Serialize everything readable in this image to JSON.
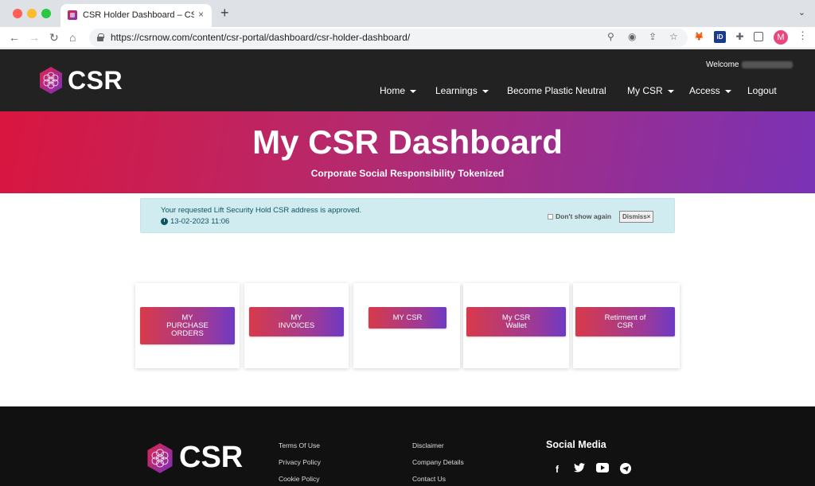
{
  "browser": {
    "tab_title": "CSR Holder Dashboard – CSRnow",
    "tab_close": "×",
    "new_tab": "+",
    "url": "https://csrnow.com/content/csr-portal/dashboard/csr-holder-dashboard/",
    "avatar_letter": "M"
  },
  "header": {
    "logo_text": "CSR",
    "welcome": "Welcome",
    "nav": [
      {
        "label": "Home",
        "dropdown": true
      },
      {
        "label": "Learnings",
        "dropdown": true
      },
      {
        "label": "Become Plastic Neutral",
        "dropdown": false
      },
      {
        "label": "My CSR",
        "dropdown": true
      },
      {
        "label": "Access",
        "dropdown": true
      },
      {
        "label": "Logout",
        "dropdown": false
      }
    ]
  },
  "hero": {
    "title": "My CSR Dashboard",
    "subtitle": "Corporate Social Responsibility Tokenized"
  },
  "notice": {
    "message": "Your requested Lift Security Hold CSR address is approved.",
    "date": "13-02-2023 11:06",
    "dont_show": "Don't show again",
    "dismiss": "Dismiss×"
  },
  "cards": [
    {
      "label": "MY\nPURCHASE\nORDERS"
    },
    {
      "label": "MY\nINVOICES"
    },
    {
      "label": "MY CSR"
    },
    {
      "label": "My CSR\nWallet"
    },
    {
      "label": "Retirment of\nCSR"
    }
  ],
  "footer": {
    "logo_text": "CSR",
    "col1": [
      "Terms Of Use",
      "Privacy Policy",
      "Cookie Policy"
    ],
    "col2": [
      "Disclaimer",
      "Company Details",
      "Contact Us"
    ],
    "social_title": "Social Media",
    "social_icons": [
      "facebook-icon",
      "twitter-icon",
      "youtube-icon",
      "telegram-icon"
    ]
  },
  "colors": {
    "hero_start": "#d9163f",
    "hero_end": "#7a32b6",
    "header_bg": "#222222",
    "notice_bg": "#d1ecf1"
  }
}
